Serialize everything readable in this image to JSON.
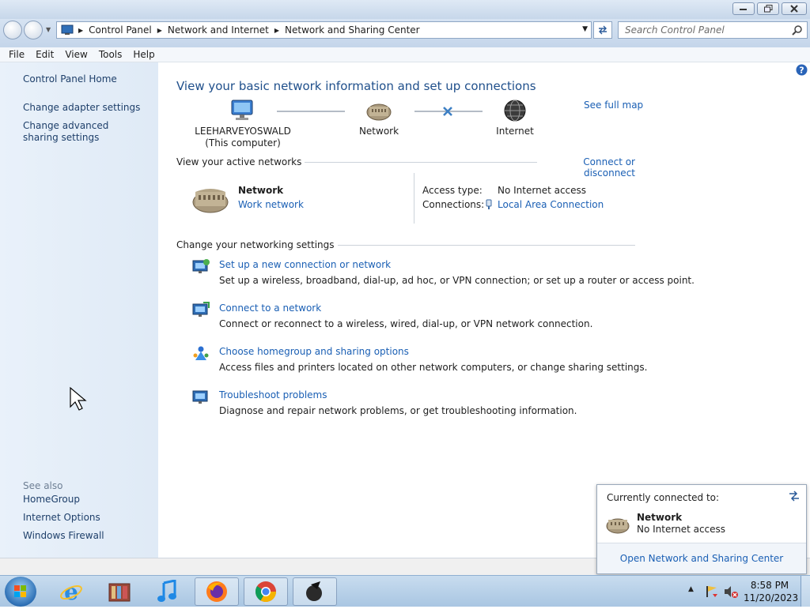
{
  "address": {
    "crumbs": [
      "Control Panel",
      "Network and Internet",
      "Network and Sharing Center"
    ],
    "search_placeholder": "Search Control Panel"
  },
  "menu": [
    "File",
    "Edit",
    "View",
    "Tools",
    "Help"
  ],
  "sidebar": {
    "home": "Control Panel Home",
    "links": [
      "Change adapter settings",
      "Change advanced sharing settings"
    ],
    "see_also_label": "See also",
    "see_also": [
      "HomeGroup",
      "Internet Options",
      "Windows Firewall"
    ]
  },
  "main": {
    "title": "View your basic network information and set up connections",
    "see_full_map": "See full map",
    "map": {
      "computer_name": "LEEHARVEYOSWALD",
      "computer_sub": "(This computer)",
      "network": "Network",
      "internet": "Internet"
    },
    "active_label": "View your active networks",
    "connect_disconnect": "Connect or disconnect",
    "active": {
      "name": "Network",
      "type": "Work network",
      "access_type_label": "Access type:",
      "access_type_value": "No Internet access",
      "connections_label": "Connections:",
      "connections_value": "Local Area Connection"
    },
    "change_label": "Change your networking settings",
    "tasks": [
      {
        "title": "Set up a new connection or network",
        "desc": "Set up a wireless, broadband, dial-up, ad hoc, or VPN connection; or set up a router or access point."
      },
      {
        "title": "Connect to a network",
        "desc": "Connect or reconnect to a wireless, wired, dial-up, or VPN network connection."
      },
      {
        "title": "Choose homegroup and sharing options",
        "desc": "Access files and printers located on other network computers, or change sharing settings."
      },
      {
        "title": "Troubleshoot problems",
        "desc": "Diagnose and repair network problems, or get troubleshooting information."
      }
    ]
  },
  "popup": {
    "heading": "Currently connected to:",
    "network": "Network",
    "status": "No Internet access",
    "link": "Open Network and Sharing Center"
  },
  "clock": {
    "time": "8:58 PM",
    "date": "11/20/2023"
  }
}
